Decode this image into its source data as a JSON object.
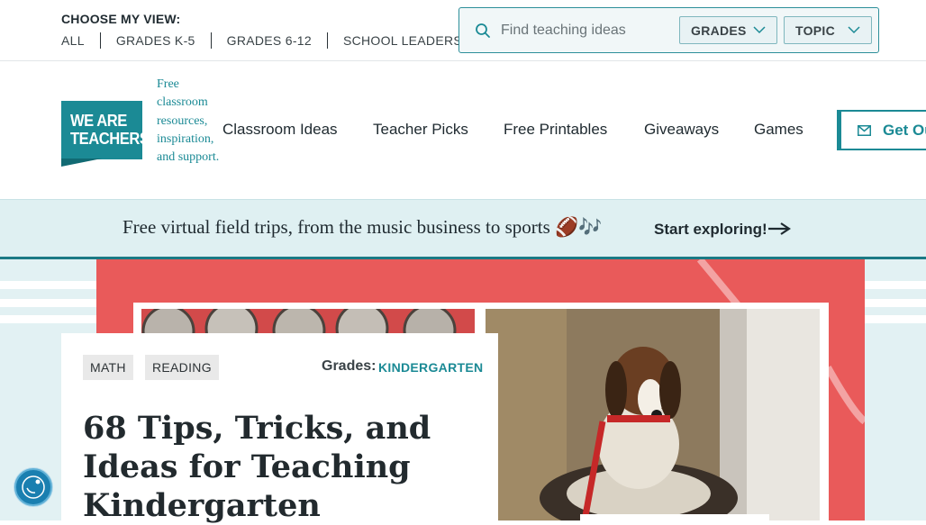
{
  "utility": {
    "view_label": "CHOOSE MY VIEW:",
    "view_links": [
      "ALL",
      "GRADES K-5",
      "GRADES 6-12",
      "SCHOOL LEADERS"
    ],
    "search": {
      "placeholder": "Find teaching ideas",
      "grades_label": "GRADES",
      "topic_label": "TOPIC"
    }
  },
  "header": {
    "logo_text": "WE ARE TEACHERS",
    "tagline": "Free classroom resources, inspiration, and support.",
    "nav": [
      "Classroom Ideas",
      "Teacher Picks",
      "Free Printables",
      "Giveaways",
      "Games"
    ],
    "cta_label": "Get Ou"
  },
  "promo": {
    "text": "Free virtual field trips, from the music business to sports 🏈🎶",
    "link": "Start exploring!"
  },
  "article": {
    "tags": [
      "MATH",
      "READING"
    ],
    "grades_label": "Grades:",
    "grades_value": "KINDERGARTEN",
    "title": "68 Tips, Tricks, and Ideas for Teaching Kindergarten"
  },
  "colors": {
    "brand_teal": "#1b8a95",
    "hero_red": "#e95a5a",
    "promo_bg": "#dff0f2"
  },
  "icons": {
    "search": "search-icon",
    "chevron": "chevron-down-icon",
    "mail": "mail-icon",
    "arrow": "arrow-right-icon",
    "accessibility": "accessibility-icon"
  }
}
